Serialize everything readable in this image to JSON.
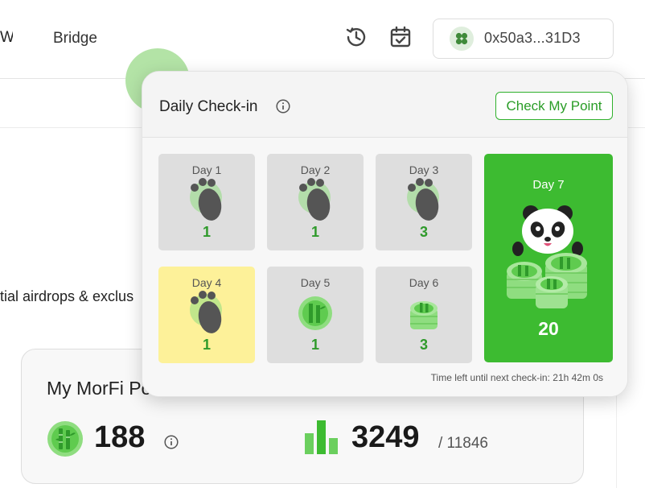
{
  "header": {
    "nav_partial": "W",
    "nav_bridge": "Bridge",
    "history_icon": "history-icon",
    "calendar_icon": "calendar-check-icon",
    "wallet_address": "0x50a3...31D3"
  },
  "background": {
    "tagline_partial": "tial airdrops & exclus",
    "points_title_partial": "My MorFi Po",
    "points_value": "188",
    "rank_value": "3249",
    "rank_total": "/ 11846"
  },
  "checkin": {
    "title": "Daily Check-in",
    "check_button": "Check My Point",
    "days": [
      {
        "label": "Day 1",
        "reward": "1",
        "state": "claimed",
        "art": "paw-print-icon"
      },
      {
        "label": "Day 2",
        "reward": "1",
        "state": "claimed",
        "art": "paw-print-icon"
      },
      {
        "label": "Day 3",
        "reward": "3",
        "state": "claimed",
        "art": "paw-print-icon"
      },
      {
        "label": "Day 4",
        "reward": "1",
        "state": "current",
        "art": "paw-print-icon"
      },
      {
        "label": "Day 5",
        "reward": "1",
        "state": "upcoming",
        "art": "bamboo-coin-icon"
      },
      {
        "label": "Day 6",
        "reward": "3",
        "state": "upcoming",
        "art": "bamboo-coin-stack-icon"
      }
    ],
    "day7": {
      "label": "Day 7",
      "reward": "20",
      "art": "panda-coins-icon"
    },
    "countdown_label": "Time left until next check-in:",
    "countdown_value": "21h 42m 0s"
  },
  "colors": {
    "accent_green": "#3dbb31",
    "reward_green": "#2f9a2b",
    "current_day_yellow": "#fdf199",
    "day_tile_gray": "#dedede"
  }
}
